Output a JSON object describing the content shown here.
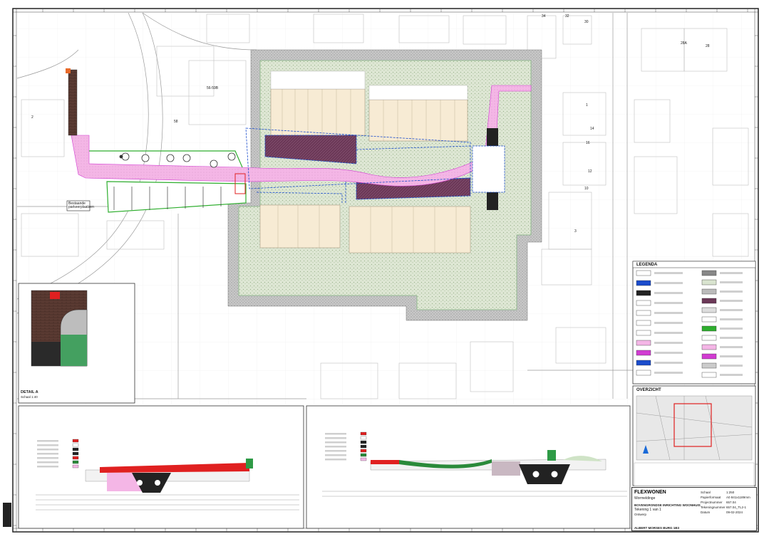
{
  "map": {
    "labels": {
      "parcel_56": "56-59B",
      "parcel_58": "58",
      "parcel_34": "34",
      "parcel_32": "32",
      "parcel_30": "30",
      "parcel_28a": "28A",
      "parcel_28": "28",
      "parcel_2": "2",
      "parcel_14": "14",
      "parcel_16": "16",
      "parcel_12": "12",
      "parcel_10": "10",
      "parcel_3": "3",
      "parcel_1": "1",
      "callout": "Bestaande parkeerplaatsen"
    }
  },
  "legend": {
    "title": "LEGENDA"
  },
  "overview": {
    "title": "OVERZICHT"
  },
  "detail": {
    "title": "DETAIL A",
    "scale": "Schaal 1:40"
  },
  "title_block": {
    "project": "FLEXWONEN",
    "place": "Wormeldinge",
    "subject": "BOVENGRONDSE INRICHTING WOONHUIS",
    "sheet": "Tekening 1 van 1",
    "status": "Ontwerp",
    "scale_label": "Schaal",
    "scale_value": "1:250",
    "paper_label": "Papierformaat",
    "paper_value": "A0 841x1189mm",
    "project_label": "Projectnummer",
    "project_value": "657.04",
    "drawing_label": "Tekeningnummer",
    "drawing_value": "657.04_TL2-1",
    "date_label": "Datum",
    "date_value": "09-02-2024",
    "footer": "ALBERT MORSES BURG 1B3"
  },
  "colors": {
    "pink": "#f4b6e6",
    "green_hatch": "#d9e4cf",
    "purple": "#6b3857",
    "grey": "#bdbdbd",
    "beige": "#f7ebd4",
    "green_line": "#2eae2e",
    "blue": "#1a4ccc",
    "magenta": "#d23cd2"
  }
}
